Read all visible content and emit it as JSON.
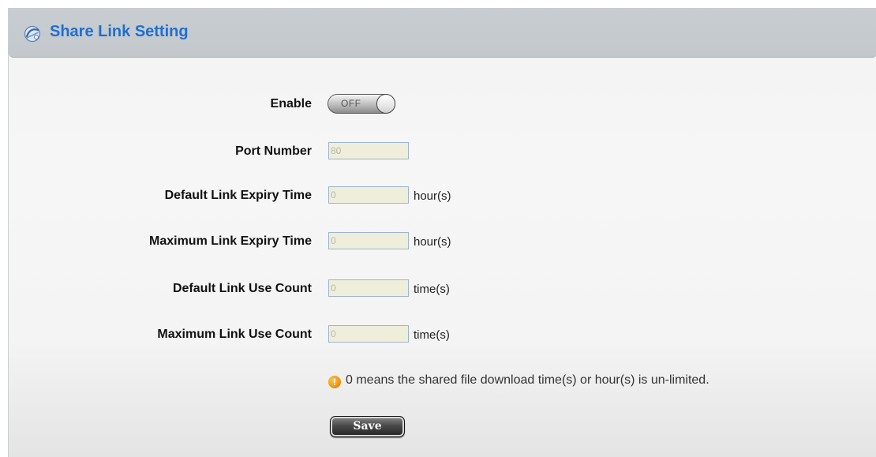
{
  "header": {
    "title": "Share Link Setting",
    "icon": "share-link-icon"
  },
  "form": {
    "enable": {
      "label": "Enable",
      "toggle_text": "OFF",
      "state": "off"
    },
    "port": {
      "label": "Port Number",
      "value": "80"
    },
    "default_expiry": {
      "label": "Default Link Expiry Time",
      "value": "0",
      "unit": "hour(s)"
    },
    "max_expiry": {
      "label": "Maximum Link Expiry Time",
      "value": "0",
      "unit": "hour(s)"
    },
    "default_count": {
      "label": "Default Link Use Count",
      "value": "0",
      "unit": "time(s)"
    },
    "max_count": {
      "label": "Maximum Link Use Count",
      "value": "0",
      "unit": "time(s)"
    },
    "note": {
      "icon": "info-icon",
      "text": "0 means the shared file download time(s) or hour(s) is un-limited."
    },
    "save_label": "Save"
  },
  "colors": {
    "title": "#1e6fd0",
    "header_bg": "#c6cbd0",
    "field_bg": "#eeeeda",
    "field_border": "#9db4cf"
  }
}
